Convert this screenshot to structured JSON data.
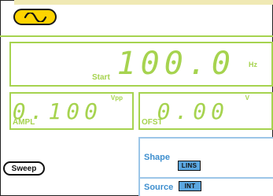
{
  "waveform": {
    "icon": "sine-wave-icon",
    "button_color": "#fed400"
  },
  "frequency": {
    "label": "Start",
    "value": "100.0",
    "unit": "Hz"
  },
  "amplitude": {
    "label": "AMPL",
    "value": "0.100",
    "unit": "Vpp"
  },
  "offset": {
    "label": "OFST",
    "value": "0.00",
    "unit": "V"
  },
  "sweep": {
    "shape_label": "Shape",
    "shape_value": "LINS",
    "source_label": "Source",
    "source_value": "INT"
  },
  "softkeys": {
    "sweep_label": "Sweep"
  },
  "colors": {
    "display_green": "#a6d34f",
    "sweep_blue": "#3e8fcf",
    "tag_blue": "#5ba7e1",
    "waveform_yellow": "#fed400"
  }
}
